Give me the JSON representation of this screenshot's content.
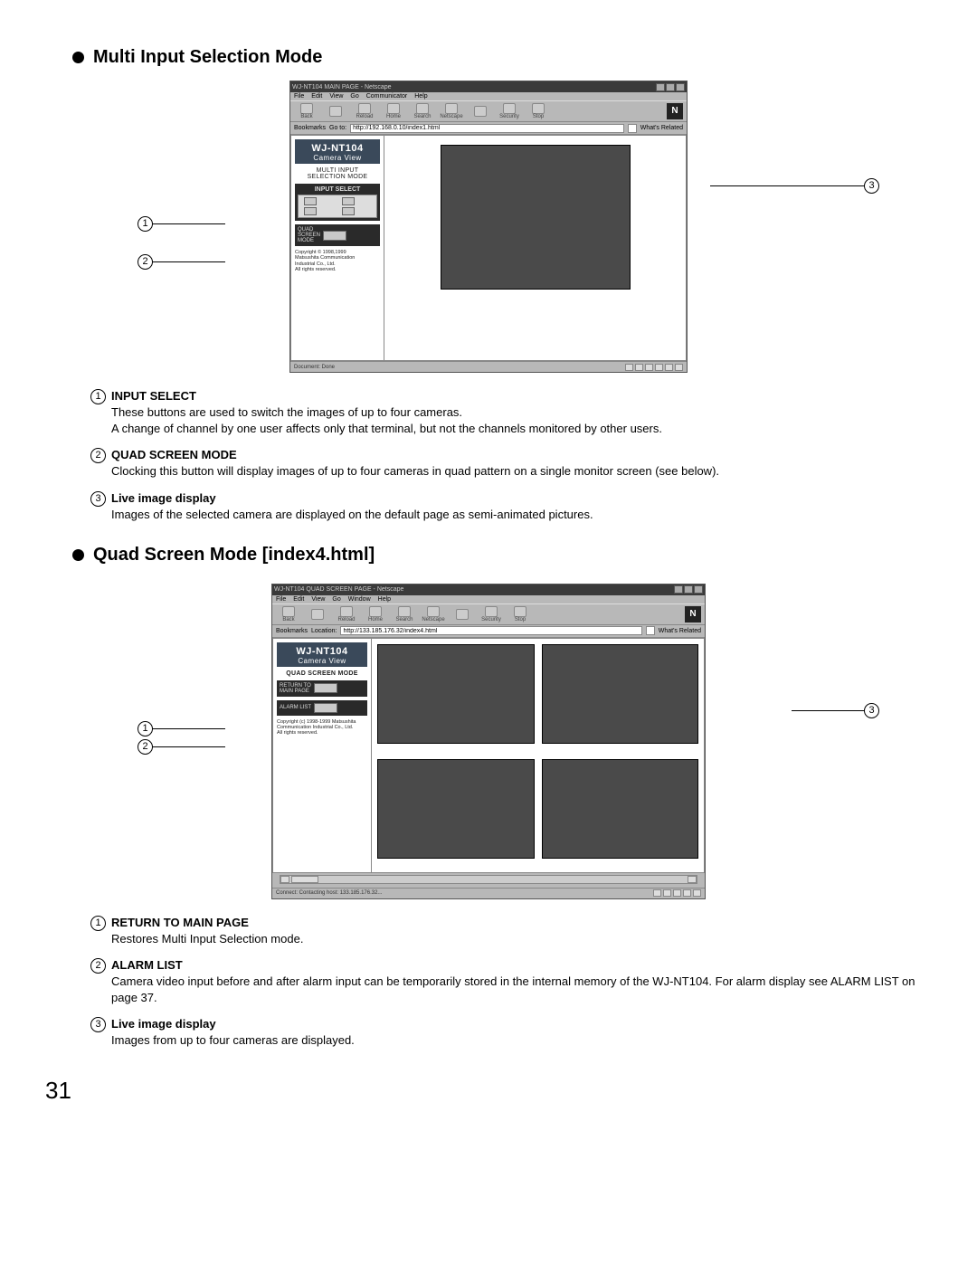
{
  "page_number": "31",
  "section1": {
    "heading": "Multi Input Selection Mode",
    "browser": {
      "title": "WJ-NT104 MAIN PAGE - Netscape",
      "menu": [
        "File",
        "Edit",
        "View",
        "Go",
        "Communicator",
        "Help"
      ],
      "toolbar": [
        "Back",
        "",
        "Reload",
        "Home",
        "Search",
        "Netscape",
        "",
        "Security",
        "",
        "Stop"
      ],
      "bookmarks_label": "Bookmarks",
      "goto_label": "Go to:",
      "addr": "http://192.168.0.10/index1.html",
      "whats_related": "What's Related",
      "status": "Document: Done",
      "sidebar": {
        "brand": "WJ-NT104",
        "brand_sub": "Camera View",
        "mode": "MULTI INPUT\nSELECTION MODE",
        "input_select_label": "INPUT SELECT",
        "inputs": [
          "1",
          "2",
          "3",
          "4"
        ],
        "quad_label": "QUAD\nSCREEN\nMODE",
        "copyright": "Copyright © 1998,1999\nMatsushita Communication\nIndustrial Co., Ltd.\nAll rights reserved."
      }
    },
    "callouts": {
      "1": {
        "title": "INPUT SELECT",
        "text": "These buttons are used to switch the images of up to four cameras.\nA change of channel by one user affects only that terminal, but not the channels monitored by other users."
      },
      "2": {
        "title": "QUAD SCREEN MODE",
        "text": "Clocking this button will display images of up to four cameras in quad pattern on a single monitor screen (see below)."
      },
      "3": {
        "title": "Live image display",
        "text": "Images of the selected camera are displayed on the default page as semi-animated pictures."
      }
    }
  },
  "section2": {
    "heading": "Quad Screen Mode [index4.html]",
    "browser": {
      "title": "WJ-NT104 QUAD SCREEN PAGE - Netscape",
      "menu": [
        "File",
        "Edit",
        "View",
        "Go",
        "Window",
        "Help"
      ],
      "toolbar": [
        "Back",
        "",
        "Reload",
        "Home",
        "Search",
        "Netscape",
        "",
        "Security",
        "Stop"
      ],
      "bookmarks_label": "Bookmarks",
      "location_label": "Location:",
      "addr": "http://133.185.176.32/index4.html",
      "whats_related": "What's Related",
      "status": "Connect: Contacting host: 133.185.176.32...",
      "sidebar": {
        "brand": "WJ-NT104",
        "brand_sub": "Camera View",
        "mode": "QUAD SCREEN MODE",
        "return_label": "RETURN TO\nMAIN PAGE",
        "alarm_label": "ALARM LIST",
        "copyright": "Copyright (c) 1998-1999 Matsushita\nCommunication Industrial Co., Ltd.\nAll rights reserved."
      }
    },
    "callouts": {
      "1": {
        "title": "RETURN TO MAIN PAGE",
        "text": "Restores Multi Input Selection mode."
      },
      "2": {
        "title": "ALARM LIST",
        "text": "Camera video input before and after alarm input can be temporarily stored in the internal memory of the WJ-NT104. For alarm display see ALARM LIST on page 37."
      },
      "3": {
        "title": "Live image display",
        "text": "Images from up to four cameras are displayed."
      }
    }
  }
}
